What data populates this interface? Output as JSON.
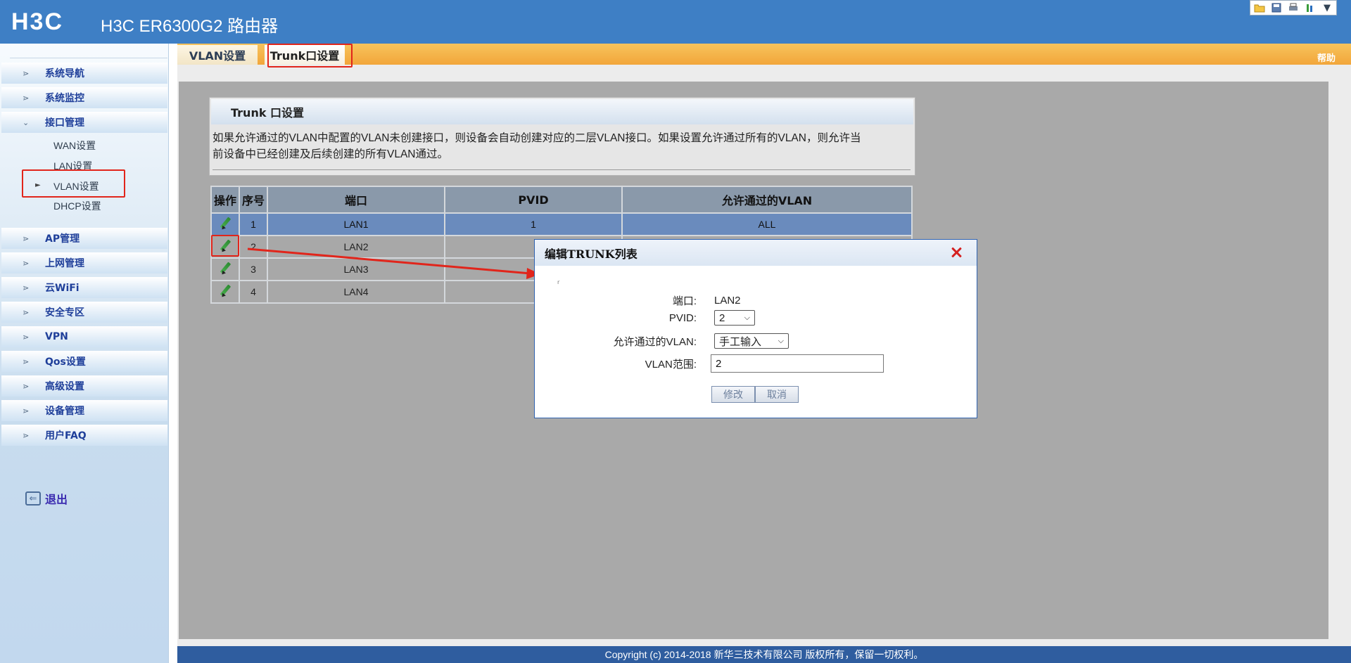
{
  "header": {
    "logo": "H3C",
    "title": "H3C ER6300G2 路由器",
    "toolbar_icons": [
      "folder-icon",
      "save-icon",
      "print-icon",
      "tools-icon",
      "chevron-down-icon"
    ]
  },
  "sidebar": {
    "items": [
      {
        "label": "系统导航"
      },
      {
        "label": "系统监控"
      },
      {
        "label": "接口管理"
      },
      {
        "label": "AP管理"
      },
      {
        "label": "上网管理"
      },
      {
        "label": "云WiFi"
      },
      {
        "label": "安全专区"
      },
      {
        "label": "VPN"
      },
      {
        "label": "Qos设置"
      },
      {
        "label": "高级设置"
      },
      {
        "label": "设备管理"
      },
      {
        "label": "用户FAQ"
      }
    ],
    "subitems": [
      {
        "label": "WAN设置"
      },
      {
        "label": "LAN设置"
      },
      {
        "label": "VLAN设置"
      },
      {
        "label": "DHCP设置"
      }
    ],
    "logout": "退出"
  },
  "tabs": {
    "vlan": "VLAN设置",
    "trunk": "Trunk口设置",
    "help": "帮助"
  },
  "panel": {
    "title": "Trunk 口设置",
    "desc_line1": "如果允许通过的VLAN中配置的VLAN未创建接口，则设备会自动创建对应的二层VLAN接口。如果设置允许通过所有的VLAN，则允许当",
    "desc_line2": "前设备中已经创建及后续创建的所有VLAN通过。"
  },
  "table": {
    "headers": [
      "操作",
      "序号",
      "端口",
      "PVID",
      "允许通过的VLAN"
    ],
    "rows": [
      {
        "index": "1",
        "port": "LAN1",
        "pvid": "1",
        "allowed": "ALL"
      },
      {
        "index": "2",
        "port": "LAN2",
        "pvid": "",
        "allowed": ""
      },
      {
        "index": "3",
        "port": "LAN3",
        "pvid": "",
        "allowed": ""
      },
      {
        "index": "4",
        "port": "LAN4",
        "pvid": "",
        "allowed": ""
      }
    ]
  },
  "dialog": {
    "title": "编辑TRUNK列表",
    "mark": "r",
    "port_label": "端口:",
    "port_value": "LAN2",
    "pvid_label": "PVID:",
    "pvid_value": "2",
    "allowed_label": "允许通过的VLAN:",
    "allowed_value": "手工输入",
    "range_label": "VLAN范围:",
    "range_value": "2",
    "modify_button": "修改",
    "cancel_button": "取消"
  },
  "footer": {
    "copyright": "Copyright (c) 2014-2018 新华三技术有限公司 版权所有，保留一切权利。"
  },
  "colors": {
    "header_bg": "#3e7fc5",
    "tabbar_bg": "#f2a63a",
    "selected_row": "#6a8bbd",
    "annotation_red": "#e1251b",
    "footer_bg": "#2f5d9f"
  }
}
